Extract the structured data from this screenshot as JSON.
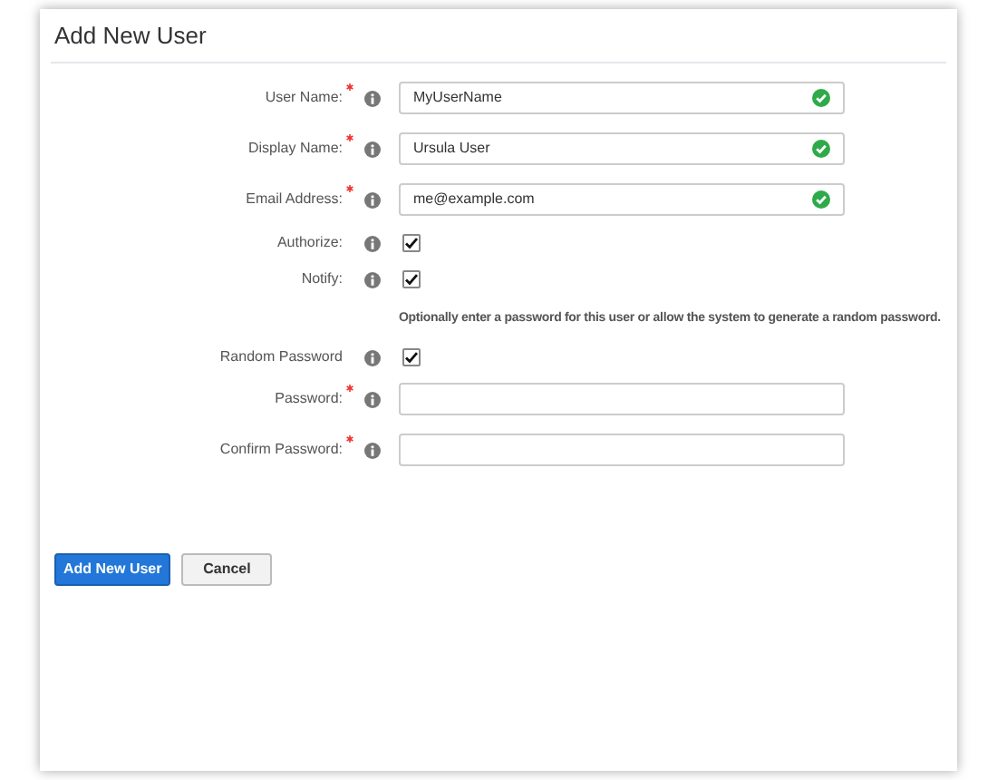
{
  "title": "Add New User",
  "fields": [
    {
      "kind": "text",
      "label": "User Name:",
      "required": true,
      "value": "MyUserName",
      "valid": true
    },
    {
      "kind": "text",
      "label": "Display Name:",
      "required": true,
      "value": "Ursula User",
      "valid": true
    },
    {
      "kind": "text",
      "label": "Email Address:",
      "required": true,
      "value": "me@example.com",
      "valid": true
    },
    {
      "kind": "checkbox",
      "label": "Authorize:",
      "required": false,
      "checked": true
    },
    {
      "kind": "checkbox",
      "label": "Notify:",
      "required": false,
      "checked": true
    },
    {
      "kind": "note",
      "text": "Optionally enter a password for this user or allow the system to generate a random password."
    },
    {
      "kind": "checkbox",
      "label": "Random Password",
      "required": false,
      "checked": true
    },
    {
      "kind": "password",
      "label": "Password:",
      "required": true,
      "valid": false
    },
    {
      "kind": "password",
      "label": "Confirm Password:",
      "required": true,
      "valid": false
    }
  ],
  "buttons": [
    {
      "label": "Add New User",
      "kind": "primary"
    },
    {
      "label": "Cancel",
      "kind": "secondary"
    }
  ]
}
